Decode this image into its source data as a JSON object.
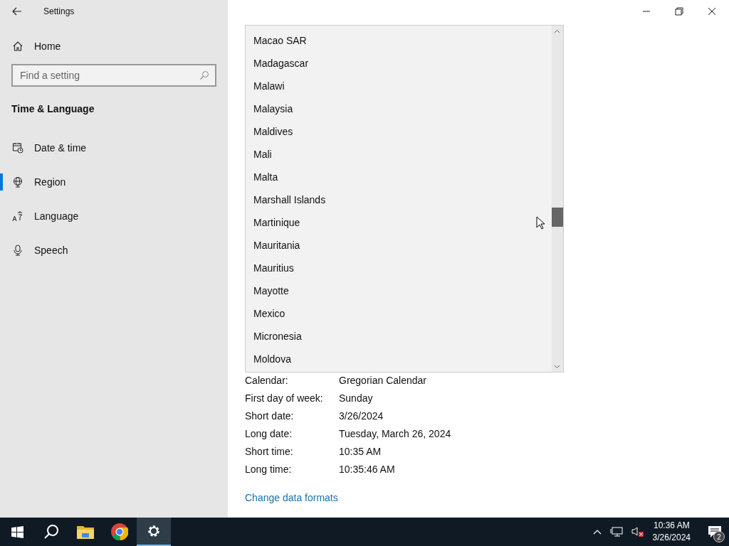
{
  "window": {
    "title": "Settings"
  },
  "sidebar": {
    "home": "Home",
    "search": {
      "placeholder": "Find a setting"
    },
    "section": "Time & Language",
    "items": [
      {
        "label": "Date & time",
        "kind": "clock",
        "selected": false
      },
      {
        "label": "Region",
        "kind": "globe",
        "selected": true
      },
      {
        "label": "Language",
        "kind": "language",
        "selected": false
      },
      {
        "label": "Speech",
        "kind": "mic",
        "selected": false
      }
    ]
  },
  "country_list": {
    "items": [
      "Macao SAR",
      "Madagascar",
      "Malawi",
      "Malaysia",
      "Maldives",
      "Mali",
      "Malta",
      "Marshall Islands",
      "Martinique",
      "Mauritania",
      "Mauritius",
      "Mayotte",
      "Mexico",
      "Micronesia",
      "Moldova"
    ]
  },
  "formats": [
    {
      "label": "Calendar:",
      "value": "Gregorian Calendar"
    },
    {
      "label": "First day of week:",
      "value": "Sunday"
    },
    {
      "label": "Short date:",
      "value": "3/26/2024"
    },
    {
      "label": "Long date:",
      "value": "Tuesday, March 26, 2024"
    },
    {
      "label": "Short time:",
      "value": "10:35 AM"
    },
    {
      "label": "Long time:",
      "value": "10:35:46 AM"
    }
  ],
  "change_link": "Change data formats",
  "taskbar": {
    "apps": [
      {
        "kind": "start",
        "selected": false
      },
      {
        "kind": "search",
        "selected": false
      },
      {
        "kind": "folder",
        "selected": false
      },
      {
        "kind": "browser",
        "selected": false
      },
      {
        "kind": "settings",
        "selected": true
      }
    ],
    "time": "10:36 AM",
    "date": "3/26/2024",
    "notifications": "2"
  }
}
